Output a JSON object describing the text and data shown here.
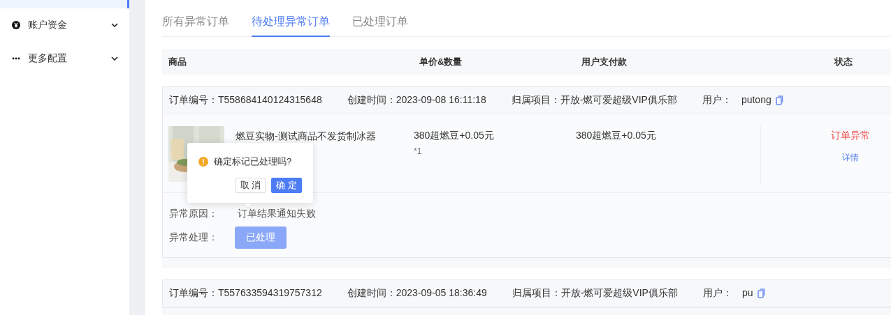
{
  "sidebar": {
    "items": [
      {
        "label": "账户资金",
        "expanded": false
      },
      {
        "label": "更多配置",
        "expanded": false
      }
    ]
  },
  "tabs": [
    {
      "label": "所有异常订单",
      "selected": false
    },
    {
      "label": "待处理异常订单",
      "selected": true
    },
    {
      "label": "已处理订单",
      "selected": false
    }
  ],
  "table": {
    "columns": [
      "商品",
      "单价&数量",
      "用户支付款",
      "状态"
    ]
  },
  "orders": [
    {
      "order_no_label": "订单编号：",
      "order_no": "T558684140124315648",
      "created_label": "创建时间：",
      "created": "2023-09-08 16:11:18",
      "project_label": "归属项目：",
      "project": "开放-燃可爱超级VIP俱乐部",
      "user_label": "用户：",
      "user": "putong",
      "product": {
        "kind": "picture",
        "name": "燃豆实物-测试商品不发货制冰器",
        "price": "380超燃豆+0.05元",
        "quantity": "*1",
        "paid": "380超燃豆+0.05元",
        "status": "订单异常",
        "detail": "详情"
      },
      "reason_label": "异常原因：",
      "reason": "订单结果通知失败",
      "handling_label": "异常处理：",
      "handling_button": "已处理",
      "popover": {
        "message": "确定标记已处理吗?",
        "cancel": "取 消",
        "confirm": "确 定"
      }
    },
    {
      "order_no_label": "订单编号：",
      "order_no": "T557633594319757312",
      "created_label": "创建时间：",
      "created": "2023-09-05 18:36:49",
      "project_label": "归属项目：",
      "project": "开放-燃可爱超级VIP俱乐部",
      "user_label": "用户：",
      "user": "pu"
    }
  ]
}
